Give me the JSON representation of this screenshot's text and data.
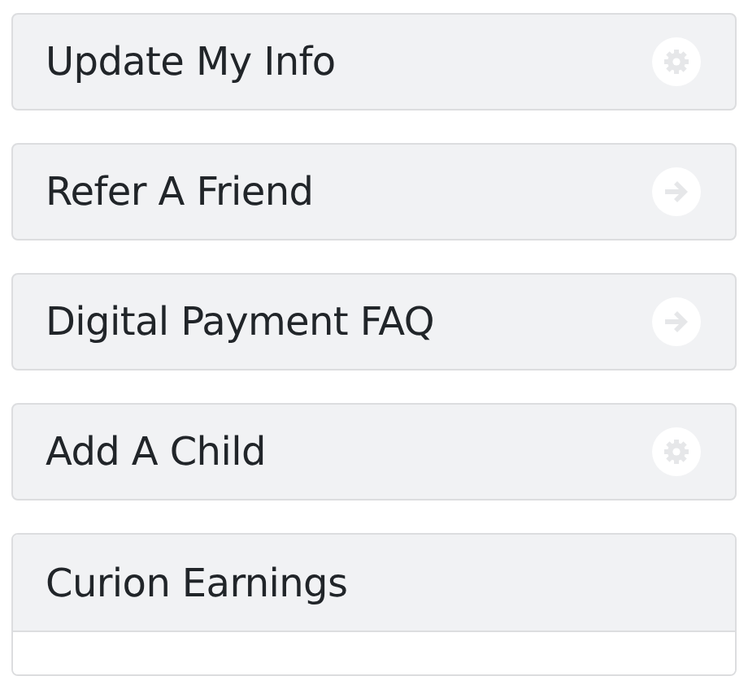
{
  "items": [
    {
      "label": "Update My Info",
      "kind": "settings"
    },
    {
      "label": "Refer A Friend",
      "kind": "forward"
    },
    {
      "label": "Digital Payment FAQ",
      "kind": "forward"
    },
    {
      "label": "Add A Child",
      "kind": "settings"
    },
    {
      "label": "Curion Earnings",
      "kind": "panel"
    }
  ]
}
